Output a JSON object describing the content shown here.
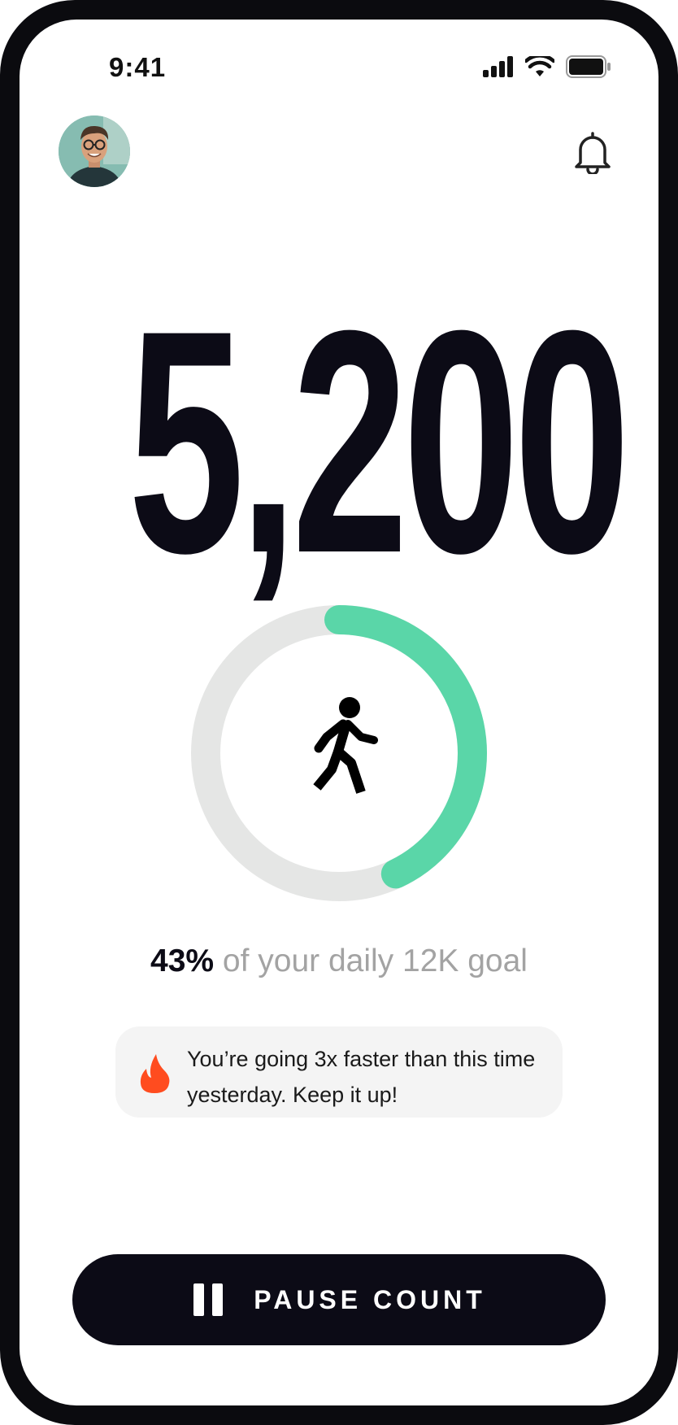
{
  "status_bar": {
    "time": "9:41",
    "icons": [
      "signal-icon",
      "wifi-icon",
      "battery-icon"
    ]
  },
  "header": {
    "avatar": "user-avatar",
    "notification_icon": "bell-icon"
  },
  "steps": {
    "count": "5,200"
  },
  "progress": {
    "fraction": 0.43,
    "icon": "walking-person-icon",
    "track_color": "#e5e6e5",
    "fill_color": "#5ad6a8"
  },
  "goal": {
    "percent": "43%",
    "text": "of your daily 12K goal"
  },
  "motivation": {
    "icon": "flame-icon",
    "icon_color": "#ff4c1f",
    "message": "You’re going 3x faster than this time yesterday. Keep it up!"
  },
  "pause_button": {
    "icon": "pause-icon",
    "label": "PAUSE COUNT"
  },
  "colors": {
    "primary": "#0c0b16",
    "secondary_text": "#a3a3a3",
    "card_bg": "#f4f4f4"
  }
}
